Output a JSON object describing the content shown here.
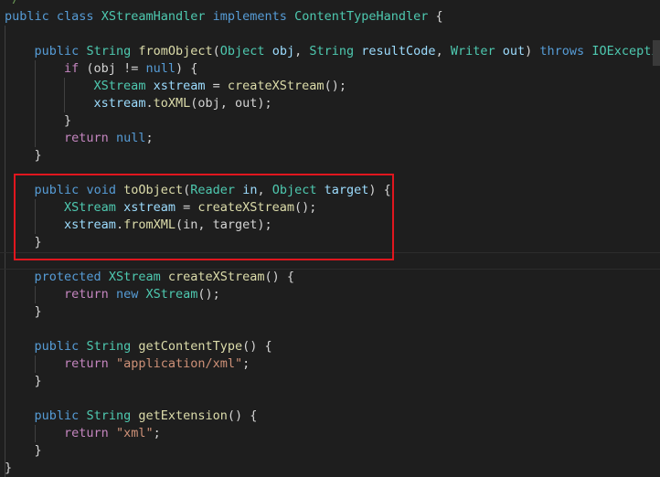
{
  "editor": {
    "colors": {
      "background": "#1e1e1e",
      "keyword": "#569cd6",
      "control": "#c586c0",
      "type": "#4ec9b0",
      "function": "#dcdcaa",
      "variable": "#9cdcfe",
      "plain": "#d4d4d4",
      "string": "#ce9178",
      "highlight_border": "#e0161e"
    },
    "lines": [
      {
        "tokens": [
          {
            "t": "*/",
            "c": "comment"
          }
        ]
      },
      {
        "tokens": [
          {
            "t": "public",
            "c": "keyword"
          },
          {
            "t": " ",
            "c": "plain"
          },
          {
            "t": "class",
            "c": "keyword"
          },
          {
            "t": " ",
            "c": "plain"
          },
          {
            "t": "XStreamHandler",
            "c": "type"
          },
          {
            "t": " ",
            "c": "plain"
          },
          {
            "t": "implements",
            "c": "keyword"
          },
          {
            "t": " ",
            "c": "plain"
          },
          {
            "t": "ContentTypeHandler",
            "c": "type"
          },
          {
            "t": " {",
            "c": "plain"
          }
        ]
      },
      {
        "tokens": []
      },
      {
        "tokens": [
          {
            "t": "    ",
            "c": "plain"
          },
          {
            "t": "public",
            "c": "keyword"
          },
          {
            "t": " ",
            "c": "plain"
          },
          {
            "t": "String",
            "c": "type"
          },
          {
            "t": " ",
            "c": "plain"
          },
          {
            "t": "fromObject",
            "c": "func"
          },
          {
            "t": "(",
            "c": "plain"
          },
          {
            "t": "Object",
            "c": "type"
          },
          {
            "t": " ",
            "c": "plain"
          },
          {
            "t": "obj",
            "c": "var"
          },
          {
            "t": ", ",
            "c": "plain"
          },
          {
            "t": "String",
            "c": "type"
          },
          {
            "t": " ",
            "c": "plain"
          },
          {
            "t": "resultCode",
            "c": "var"
          },
          {
            "t": ", ",
            "c": "plain"
          },
          {
            "t": "Writer",
            "c": "type"
          },
          {
            "t": " ",
            "c": "plain"
          },
          {
            "t": "out",
            "c": "var"
          },
          {
            "t": ") ",
            "c": "plain"
          },
          {
            "t": "throws",
            "c": "keyword"
          },
          {
            "t": " ",
            "c": "plain"
          },
          {
            "t": "IOException",
            "c": "type"
          },
          {
            "t": " {",
            "c": "plain"
          }
        ]
      },
      {
        "tokens": [
          {
            "t": "        ",
            "c": "plain"
          },
          {
            "t": "if",
            "c": "control"
          },
          {
            "t": " (obj != ",
            "c": "plain"
          },
          {
            "t": "null",
            "c": "keyword"
          },
          {
            "t": ") {",
            "c": "plain"
          }
        ]
      },
      {
        "tokens": [
          {
            "t": "            ",
            "c": "plain"
          },
          {
            "t": "XStream",
            "c": "type"
          },
          {
            "t": " ",
            "c": "plain"
          },
          {
            "t": "xstream",
            "c": "var"
          },
          {
            "t": " = ",
            "c": "plain"
          },
          {
            "t": "createXStream",
            "c": "func"
          },
          {
            "t": "();",
            "c": "plain"
          }
        ]
      },
      {
        "tokens": [
          {
            "t": "            ",
            "c": "plain"
          },
          {
            "t": "xstream",
            "c": "var"
          },
          {
            "t": ".",
            "c": "plain"
          },
          {
            "t": "toXML",
            "c": "func"
          },
          {
            "t": "(obj, out);",
            "c": "plain"
          }
        ]
      },
      {
        "tokens": [
          {
            "t": "        }",
            "c": "plain"
          }
        ]
      },
      {
        "tokens": [
          {
            "t": "        ",
            "c": "plain"
          },
          {
            "t": "return",
            "c": "control"
          },
          {
            "t": " ",
            "c": "plain"
          },
          {
            "t": "null",
            "c": "keyword"
          },
          {
            "t": ";",
            "c": "plain"
          }
        ]
      },
      {
        "tokens": [
          {
            "t": "    }",
            "c": "plain"
          }
        ]
      },
      {
        "tokens": []
      },
      {
        "tokens": [
          {
            "t": "    ",
            "c": "plain"
          },
          {
            "t": "public",
            "c": "keyword"
          },
          {
            "t": " ",
            "c": "plain"
          },
          {
            "t": "void",
            "c": "keyword"
          },
          {
            "t": " ",
            "c": "plain"
          },
          {
            "t": "toObject",
            "c": "func"
          },
          {
            "t": "(",
            "c": "plain"
          },
          {
            "t": "Reader",
            "c": "type"
          },
          {
            "t": " ",
            "c": "plain"
          },
          {
            "t": "in",
            "c": "var"
          },
          {
            "t": ", ",
            "c": "plain"
          },
          {
            "t": "Object",
            "c": "type"
          },
          {
            "t": " ",
            "c": "plain"
          },
          {
            "t": "target",
            "c": "var"
          },
          {
            "t": ") {",
            "c": "plain"
          }
        ]
      },
      {
        "tokens": [
          {
            "t": "        ",
            "c": "plain"
          },
          {
            "t": "XStream",
            "c": "type"
          },
          {
            "t": " ",
            "c": "plain"
          },
          {
            "t": "xstream",
            "c": "var"
          },
          {
            "t": " = ",
            "c": "plain"
          },
          {
            "t": "createXStream",
            "c": "func"
          },
          {
            "t": "();",
            "c": "plain"
          }
        ]
      },
      {
        "tokens": [
          {
            "t": "        ",
            "c": "plain"
          },
          {
            "t": "xstream",
            "c": "var"
          },
          {
            "t": ".",
            "c": "plain"
          },
          {
            "t": "fromXML",
            "c": "func"
          },
          {
            "t": "(in, target);",
            "c": "plain"
          }
        ]
      },
      {
        "tokens": [
          {
            "t": "    }",
            "c": "plain"
          }
        ]
      },
      {
        "tokens": []
      },
      {
        "tokens": [
          {
            "t": "    ",
            "c": "plain"
          },
          {
            "t": "protected",
            "c": "keyword"
          },
          {
            "t": " ",
            "c": "plain"
          },
          {
            "t": "XStream",
            "c": "type"
          },
          {
            "t": " ",
            "c": "plain"
          },
          {
            "t": "createXStream",
            "c": "func"
          },
          {
            "t": "() {",
            "c": "plain"
          }
        ]
      },
      {
        "tokens": [
          {
            "t": "        ",
            "c": "plain"
          },
          {
            "t": "return",
            "c": "control"
          },
          {
            "t": " ",
            "c": "plain"
          },
          {
            "t": "new",
            "c": "keyword"
          },
          {
            "t": " ",
            "c": "plain"
          },
          {
            "t": "XStream",
            "c": "type"
          },
          {
            "t": "();",
            "c": "plain"
          }
        ]
      },
      {
        "tokens": [
          {
            "t": "    }",
            "c": "plain"
          }
        ]
      },
      {
        "tokens": []
      },
      {
        "tokens": [
          {
            "t": "    ",
            "c": "plain"
          },
          {
            "t": "public",
            "c": "keyword"
          },
          {
            "t": " ",
            "c": "plain"
          },
          {
            "t": "String",
            "c": "type"
          },
          {
            "t": " ",
            "c": "plain"
          },
          {
            "t": "getContentType",
            "c": "func"
          },
          {
            "t": "() {",
            "c": "plain"
          }
        ]
      },
      {
        "tokens": [
          {
            "t": "        ",
            "c": "plain"
          },
          {
            "t": "return",
            "c": "control"
          },
          {
            "t": " ",
            "c": "plain"
          },
          {
            "t": "\"application/xml\"",
            "c": "string"
          },
          {
            "t": ";",
            "c": "plain"
          }
        ]
      },
      {
        "tokens": [
          {
            "t": "    }",
            "c": "plain"
          }
        ]
      },
      {
        "tokens": []
      },
      {
        "tokens": [
          {
            "t": "    ",
            "c": "plain"
          },
          {
            "t": "public",
            "c": "keyword"
          },
          {
            "t": " ",
            "c": "plain"
          },
          {
            "t": "String",
            "c": "type"
          },
          {
            "t": " ",
            "c": "plain"
          },
          {
            "t": "getExtension",
            "c": "func"
          },
          {
            "t": "() {",
            "c": "plain"
          }
        ]
      },
      {
        "tokens": [
          {
            "t": "        ",
            "c": "plain"
          },
          {
            "t": "return",
            "c": "control"
          },
          {
            "t": " ",
            "c": "plain"
          },
          {
            "t": "\"xml\"",
            "c": "string"
          },
          {
            "t": ";",
            "c": "plain"
          }
        ]
      },
      {
        "tokens": [
          {
            "t": "    }",
            "c": "plain"
          }
        ]
      },
      {
        "tokens": [
          {
            "t": "}",
            "c": "plain"
          }
        ]
      }
    ]
  }
}
